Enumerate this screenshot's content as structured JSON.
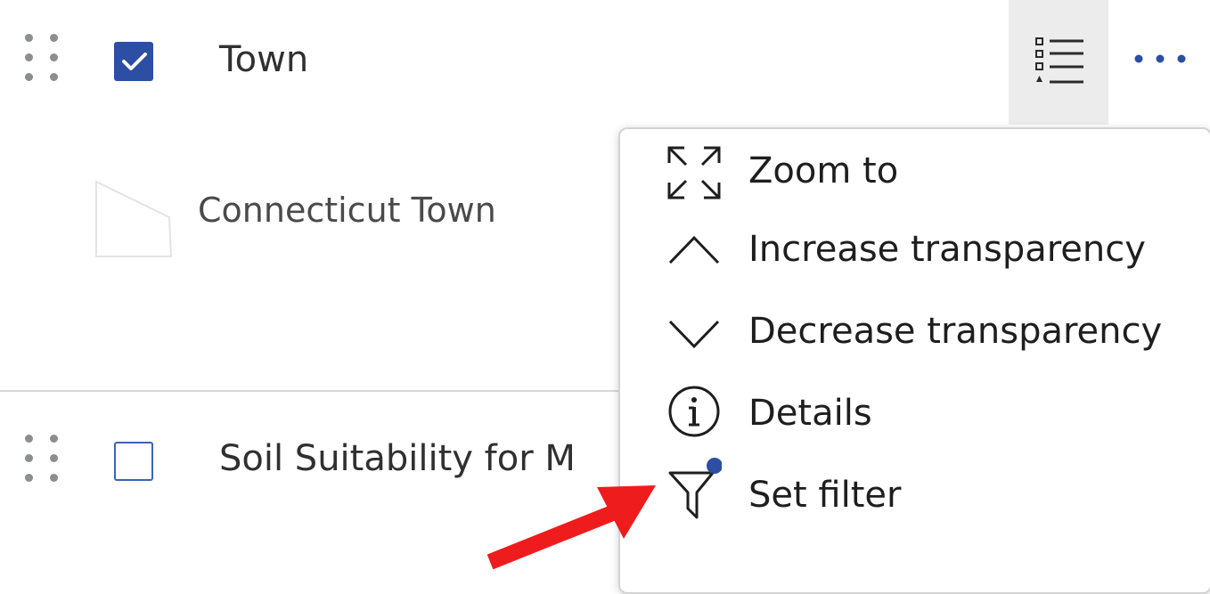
{
  "layers": [
    {
      "title": "Town",
      "checked": true,
      "legend": {
        "label": "Connecticut Town"
      }
    },
    {
      "title": "Soil Suitability for M",
      "checked": false
    }
  ],
  "context_menu": {
    "items": [
      {
        "label": "Zoom to",
        "icon": "zoom-to-icon"
      },
      {
        "label": "Increase transparency",
        "icon": "chevron-up-icon"
      },
      {
        "label": "Decrease transparency",
        "icon": "chevron-down-icon"
      },
      {
        "label": "Details",
        "icon": "info-icon"
      },
      {
        "label": "Set filter",
        "icon": "filter-icon"
      }
    ]
  },
  "colors": {
    "accent": "#2c4ea3",
    "annotation_arrow": "#ee1c1c",
    "filter_dot": "#2c4ea3"
  }
}
